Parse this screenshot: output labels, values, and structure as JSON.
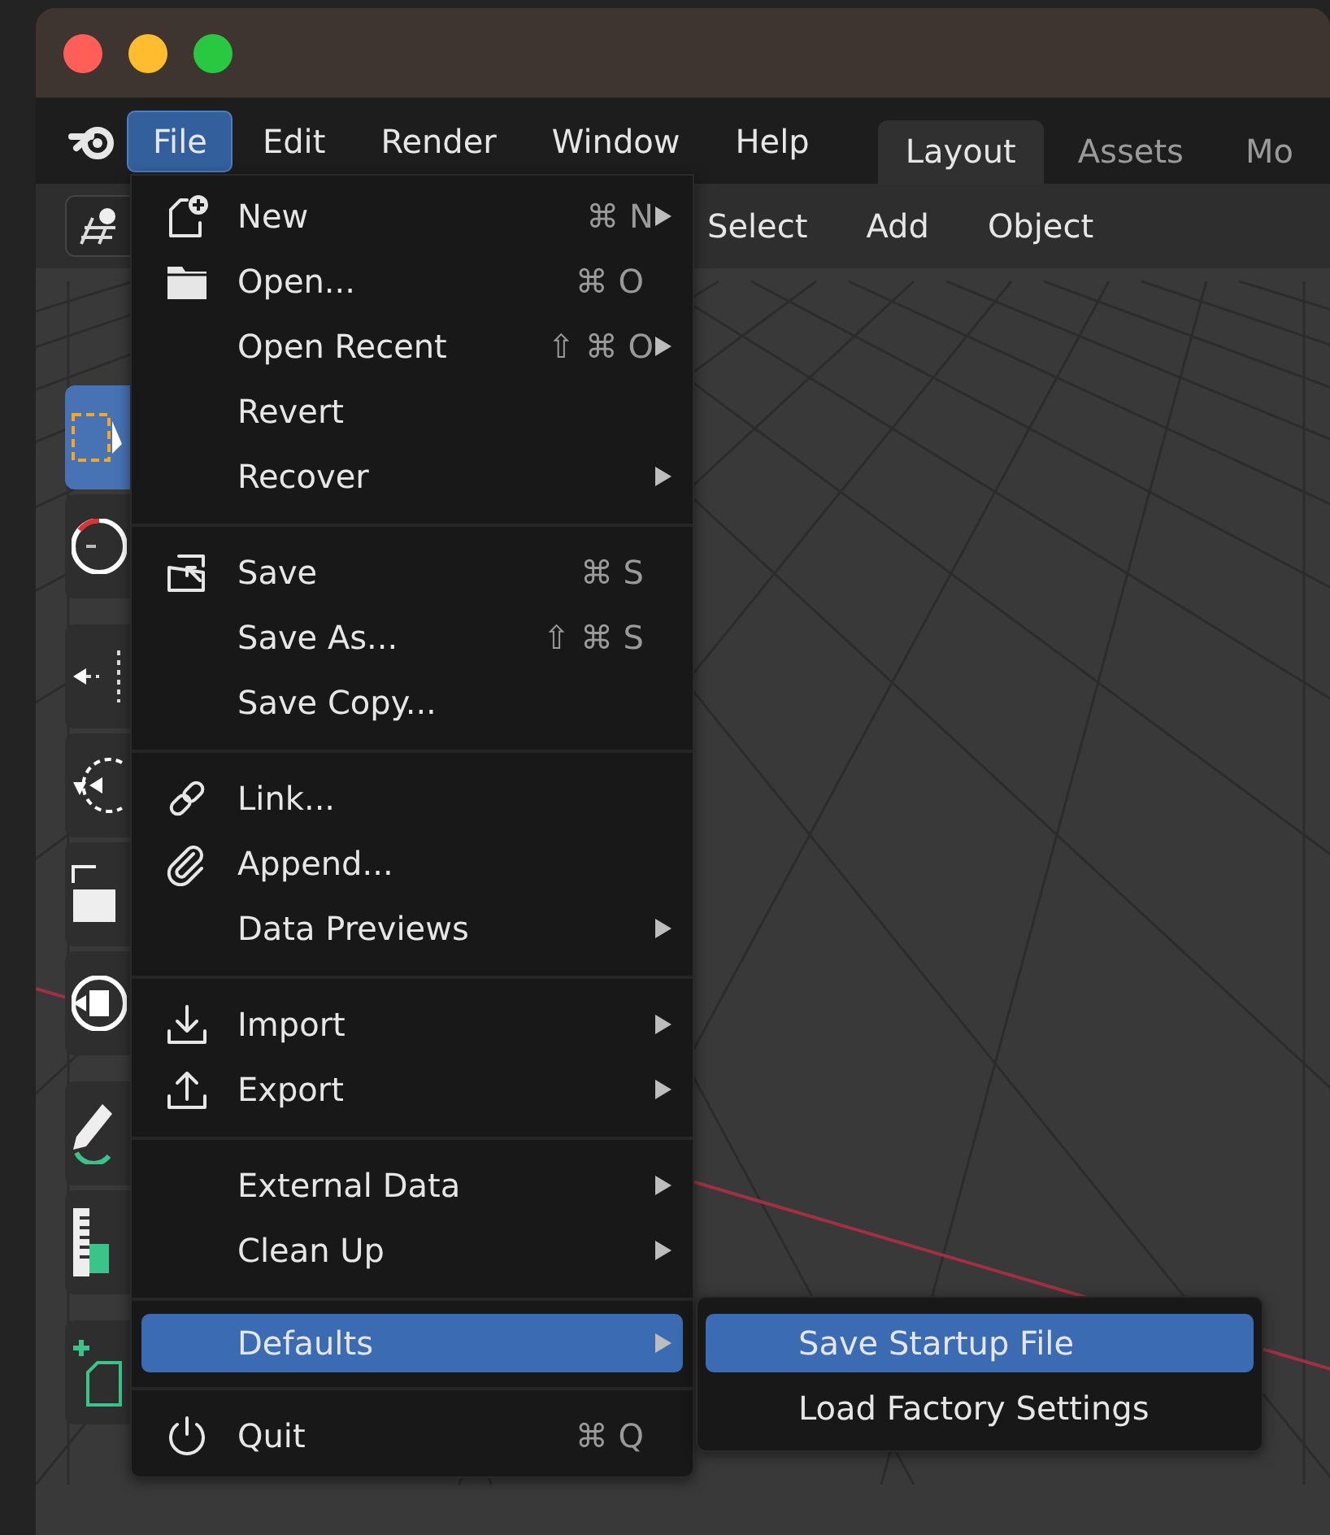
{
  "window": {
    "traffic_lights": [
      {
        "color": "#ff5f57"
      },
      {
        "color": "#febc2e"
      },
      {
        "color": "#28c840"
      }
    ]
  },
  "menubar": {
    "items": [
      {
        "label": "File",
        "selected": true
      },
      {
        "label": "Edit",
        "selected": false
      },
      {
        "label": "Render",
        "selected": false
      },
      {
        "label": "Window",
        "selected": false
      },
      {
        "label": "Help",
        "selected": false
      }
    ],
    "workspace_tabs": [
      {
        "label": "Layout",
        "selected": true
      },
      {
        "label": "Assets",
        "selected": false
      },
      {
        "label": "Mo",
        "selected": false
      }
    ]
  },
  "viewport": {
    "header_menus": [
      "Select",
      "Add",
      "Object"
    ],
    "tool_groups": [
      {
        "tools": [
          {
            "kind": "select",
            "selected": true
          },
          {
            "kind": "cursor",
            "selected": false
          }
        ]
      },
      {
        "tools": [
          {
            "kind": "move",
            "selected": false
          },
          {
            "kind": "rotate",
            "selected": false
          },
          {
            "kind": "scale",
            "selected": false
          },
          {
            "kind": "transform",
            "selected": false
          }
        ]
      },
      {
        "tools": [
          {
            "kind": "annotate",
            "selected": false
          },
          {
            "kind": "measure",
            "selected": false
          }
        ]
      },
      {
        "tools": [
          {
            "kind": "add_cube",
            "selected": false
          }
        ]
      }
    ]
  },
  "file_menu": {
    "sections": [
      {
        "items": [
          {
            "label": "New",
            "kind": "new",
            "shortcut": "⌘ N",
            "submenu": true,
            "selected": false
          },
          {
            "label": "Open...",
            "kind": "open",
            "shortcut": "⌘ O",
            "submenu": false,
            "selected": false
          },
          {
            "label": "Open Recent",
            "shortcut": "⇧ ⌘ O",
            "submenu": true,
            "selected": false
          },
          {
            "label": "Revert",
            "submenu": false,
            "selected": false
          },
          {
            "label": "Recover",
            "submenu": true,
            "selected": false
          }
        ]
      },
      {
        "items": [
          {
            "label": "Save",
            "kind": "save",
            "shortcut": "⌘ S",
            "submenu": false,
            "selected": false
          },
          {
            "label": "Save As...",
            "shortcut": "⇧ ⌘ S",
            "submenu": false,
            "selected": false
          },
          {
            "label": "Save Copy...",
            "submenu": false,
            "selected": false
          }
        ]
      },
      {
        "items": [
          {
            "label": "Link...",
            "kind": "link",
            "submenu": false,
            "selected": false
          },
          {
            "label": "Append...",
            "kind": "append",
            "submenu": false,
            "selected": false
          },
          {
            "label": "Data Previews",
            "submenu": true,
            "selected": false
          }
        ]
      },
      {
        "items": [
          {
            "label": "Import",
            "kind": "import",
            "submenu": true,
            "selected": false
          },
          {
            "label": "Export",
            "kind": "export",
            "submenu": true,
            "selected": false
          }
        ]
      },
      {
        "items": [
          {
            "label": "External Data",
            "submenu": true,
            "selected": false
          },
          {
            "label": "Clean Up",
            "submenu": true,
            "selected": false
          }
        ]
      },
      {
        "items": [
          {
            "label": "Defaults",
            "submenu": true,
            "selected": true
          }
        ]
      },
      {
        "items": [
          {
            "label": "Quit",
            "kind": "quit",
            "shortcut": "⌘ Q",
            "submenu": false,
            "selected": false
          }
        ]
      }
    ]
  },
  "defaults_submenu": {
    "items": [
      {
        "label": "Save Startup File",
        "selected": true
      },
      {
        "label": "Load Factory Settings",
        "selected": false
      }
    ]
  }
}
